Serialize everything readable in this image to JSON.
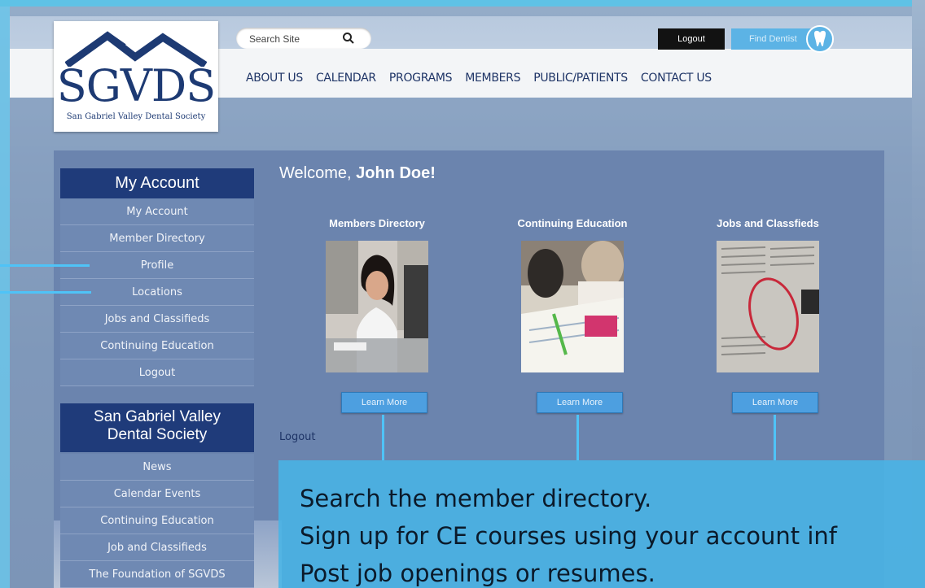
{
  "search": {
    "placeholder": "Search Site"
  },
  "header_buttons": {
    "logout": "Logout",
    "find_dentist": "Find Dentist"
  },
  "logo": {
    "text": "SGVDS",
    "subtitle": "San Gabriel Valley Dental Society"
  },
  "nav": [
    "ABOUT US",
    "CALENDAR",
    "PROGRAMS",
    "MEMBERS",
    "PUBLIC/PATIENTS",
    "CONTACT US"
  ],
  "sidebar": {
    "account_header": "My Account",
    "account_items": [
      "My Account",
      "Member Directory",
      "Profile",
      "Locations",
      "Jobs and Classifieds",
      "Continuing Education",
      "Logout"
    ],
    "society_header_line1": "San Gabriel Valley",
    "society_header_line2": "Dental Society",
    "society_items": [
      "News",
      "Calendar Events",
      "Continuing Education",
      "Job and Classifieds",
      "The Foundation of SGVDS"
    ]
  },
  "main": {
    "welcome_prefix": "Welcome,",
    "welcome_name": "John Doe!",
    "cards": [
      {
        "title": "Members Directory",
        "button": "Learn More"
      },
      {
        "title": "Continuing Education",
        "button": "Learn More"
      },
      {
        "title": "Jobs and Classfieds",
        "button": "Learn More"
      }
    ],
    "logout_link": "Logout"
  },
  "callout": {
    "lines": [
      "Search the member directory.",
      "Sign up for CE courses using your account inf",
      "Post job openings or resumes."
    ]
  },
  "colors": {
    "brand_navy": "#1f3b7a",
    "accent_cyan": "#4fc3f7",
    "button_blue": "#4d9fe0"
  }
}
